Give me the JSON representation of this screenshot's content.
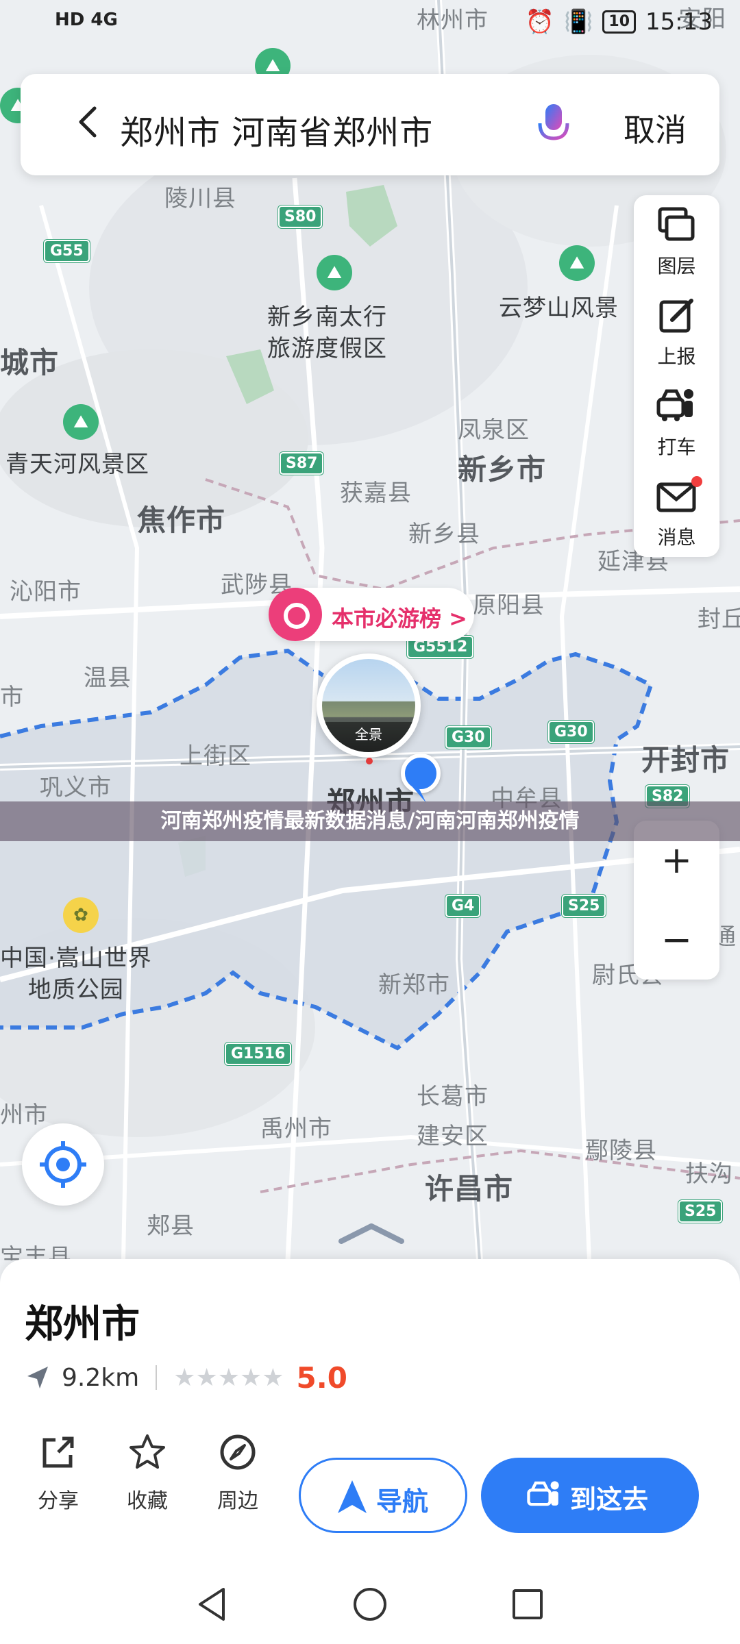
{
  "status_bar": {
    "carrier": "HD 4G",
    "time": "15:13",
    "battery": "10"
  },
  "search": {
    "query": "郑州市 河南省郑州市",
    "cancel_label": "取消"
  },
  "map": {
    "labels": [
      {
        "text": "林州市",
        "cls": "lbl"
      },
      {
        "text": "安阳",
        "cls": "lbl"
      },
      {
        "text": "陵川县",
        "cls": "lbl"
      },
      {
        "text": "新乡南太行\n旅游度假区",
        "cls": "lbl dark"
      },
      {
        "text": "云梦山风景",
        "cls": "lbl dark"
      },
      {
        "text": "城市",
        "cls": "lbl city"
      },
      {
        "text": "青天河风景区",
        "cls": "lbl dark"
      },
      {
        "text": "凤泉区",
        "cls": "lbl"
      },
      {
        "text": "新乡市",
        "cls": "lbl city"
      },
      {
        "text": "获嘉县",
        "cls": "lbl"
      },
      {
        "text": "焦作市",
        "cls": "lbl city"
      },
      {
        "text": "新乡县",
        "cls": "lbl"
      },
      {
        "text": "沁阳市",
        "cls": "lbl"
      },
      {
        "text": "武陟县",
        "cls": "lbl"
      },
      {
        "text": "延津县",
        "cls": "lbl"
      },
      {
        "text": "原阳县",
        "cls": "lbl"
      },
      {
        "text": "封丘",
        "cls": "lbl"
      },
      {
        "text": "温县",
        "cls": "lbl"
      },
      {
        "text": "市",
        "cls": "lbl"
      },
      {
        "text": "上街区",
        "cls": "lbl"
      },
      {
        "text": "巩义市",
        "cls": "lbl"
      },
      {
        "text": "郑州市",
        "cls": "lbl city dark"
      },
      {
        "text": "中牟县",
        "cls": "lbl"
      },
      {
        "text": "开封市",
        "cls": "lbl city"
      },
      {
        "text": "中国·嵩山世界\n地质公园",
        "cls": "lbl dark"
      },
      {
        "text": "新郑市",
        "cls": "lbl"
      },
      {
        "text": "尉氏县",
        "cls": "lbl"
      },
      {
        "text": "通",
        "cls": "lbl"
      },
      {
        "text": "长葛市\n建安区",
        "cls": "lbl"
      },
      {
        "text": "州市",
        "cls": "lbl"
      },
      {
        "text": "禹州市",
        "cls": "lbl"
      },
      {
        "text": "鄢陵县",
        "cls": "lbl"
      },
      {
        "text": "许昌市",
        "cls": "lbl city"
      },
      {
        "text": "扶沟",
        "cls": "lbl"
      },
      {
        "text": "郏县",
        "cls": "lbl"
      },
      {
        "text": "宝丰县",
        "cls": "lbl"
      }
    ],
    "roads": [
      "G55",
      "S80",
      "S87",
      "G5512",
      "G30",
      "G30",
      "S82",
      "G4",
      "S25",
      "G1516",
      "S25"
    ],
    "pill_label": "本市必游榜 >",
    "pano_label": "全景"
  },
  "tools": [
    {
      "label": "图层",
      "icon": "layers-icon"
    },
    {
      "label": "上报",
      "icon": "report-icon"
    },
    {
      "label": "打车",
      "icon": "taxi-icon"
    },
    {
      "label": "消息",
      "icon": "message-icon"
    }
  ],
  "zoom": {
    "in": "+",
    "out": "−"
  },
  "banner": "河南郑州疫情最新数据消息/河南河南郑州疫情",
  "place": {
    "name": "郑州市",
    "distance": "9.2km",
    "rating": 5.0,
    "rating_text": "5.0",
    "stars": "★★★★★"
  },
  "actions": [
    {
      "label": "分享",
      "icon": "share-icon"
    },
    {
      "label": "收藏",
      "icon": "star-icon"
    },
    {
      "label": "周边",
      "icon": "compass-icon"
    }
  ],
  "navigate_label": "导航",
  "go_label": "到这去"
}
